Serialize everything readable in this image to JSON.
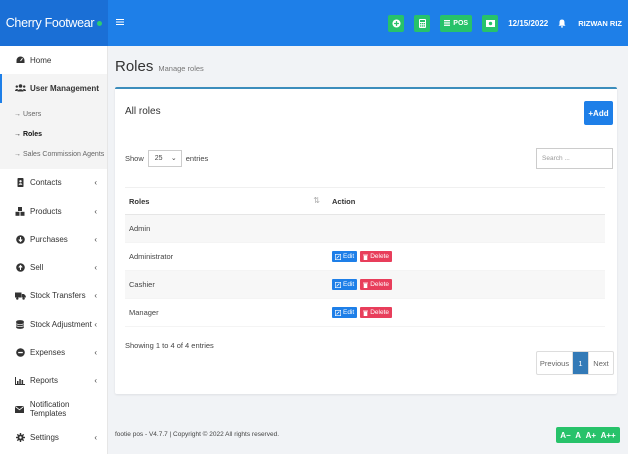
{
  "app": {
    "brand": "Cherry Footwear",
    "date": "12/15/2022",
    "user": "RIZWAN RIZ",
    "pos_label": "POS"
  },
  "icons": {
    "hamburger": "menu-icon",
    "calculator": "calculator-icon",
    "add_circle": "plus-circle-icon",
    "cash": "money-icon",
    "bell": "bell-icon"
  },
  "sidebar": {
    "items": [
      {
        "label": "Home",
        "icon": "tachometer-icon"
      },
      {
        "label": "User Management",
        "icon": "users-icon",
        "active": true
      },
      {
        "label": "Contacts",
        "icon": "address-book-icon"
      },
      {
        "label": "Products",
        "icon": "cubes-icon"
      },
      {
        "label": "Purchases",
        "icon": "arrow-circle-down-icon"
      },
      {
        "label": "Sell",
        "icon": "arrow-circle-up-icon"
      },
      {
        "label": "Stock Transfers",
        "icon": "truck-icon"
      },
      {
        "label": "Stock Adjustment",
        "icon": "database-icon"
      },
      {
        "label": "Expenses",
        "icon": "minus-circle-icon"
      },
      {
        "label": "Reports",
        "icon": "chart-icon"
      },
      {
        "label": "Notification Templates",
        "icon": "envelope-icon"
      },
      {
        "label": "Settings",
        "icon": "cog-icon"
      }
    ],
    "subitems": [
      {
        "label": "→ Users"
      },
      {
        "label": "→ Roles",
        "current": true
      },
      {
        "label": "→ Sales Commission Agents"
      }
    ]
  },
  "page": {
    "title": "Roles",
    "subtitle": "Manage roles"
  },
  "box": {
    "title": "All roles",
    "add_label": "+Add",
    "show_label": "Show",
    "entries_label": "entries",
    "page_size": "25",
    "search_placeholder": "Search ..."
  },
  "table": {
    "columns": [
      "Roles",
      "Action"
    ],
    "rows": [
      {
        "role": "Admin",
        "actions": false
      },
      {
        "role": "Administrator",
        "actions": true
      },
      {
        "role": "Cashier",
        "actions": true
      },
      {
        "role": "Manager",
        "actions": true
      }
    ],
    "edit_label": "Edit",
    "delete_label": "Delete"
  },
  "pagination": {
    "info": "Showing 1 to 4 of 4 entries",
    "previous": "Previous",
    "current": "1",
    "next": "Next"
  },
  "footer": {
    "text": "footie pos - V4.7.7 | Copyright © 2022 All rights reserved.",
    "font_controls": [
      "A−",
      "A",
      "A+",
      "A++"
    ]
  },
  "colors": {
    "brand": "#1a6fd6",
    "navbar": "#1e7fe8",
    "accent_green": "#27c26a",
    "delete_red": "#e83e5b"
  }
}
